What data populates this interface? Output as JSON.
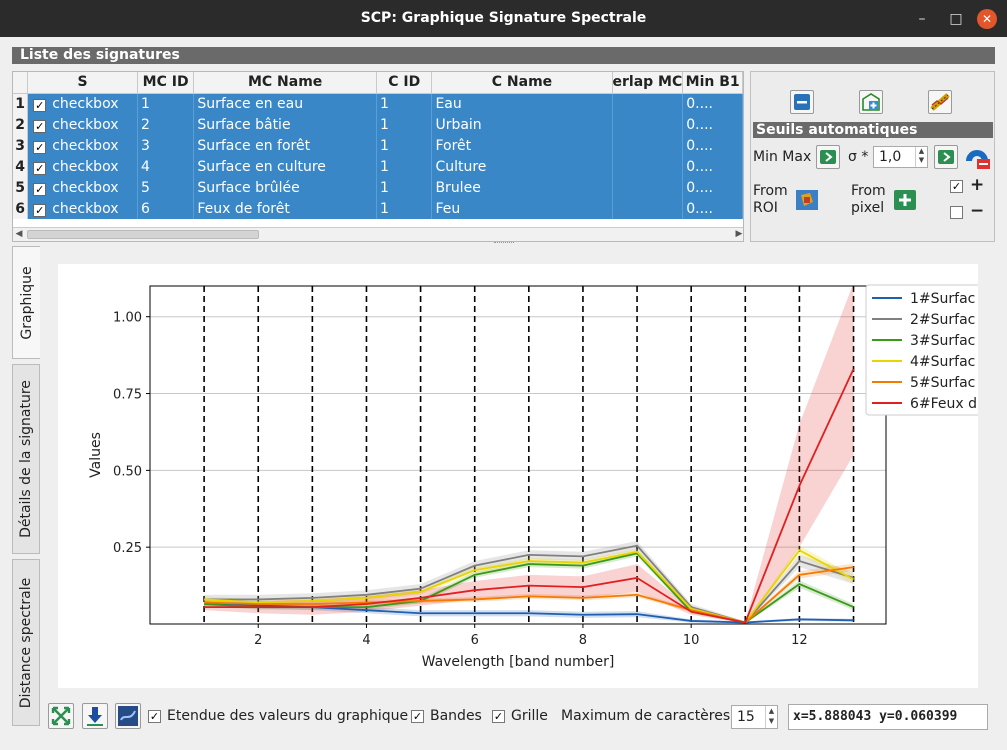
{
  "window": {
    "title": "SCP: Graphique Signature Spectrale",
    "min": "–",
    "max": "□",
    "close": "✕"
  },
  "list": {
    "title": "Liste des signatures",
    "columns": [
      "S",
      "MC ID",
      "MC Name",
      "C ID",
      "C Name",
      "erlap MC",
      "Min B1"
    ],
    "rows": [
      {
        "n": "1",
        "s": "checkbox",
        "mcid": "1",
        "mcname": "Surface en eau",
        "cid": "1",
        "cname": "Eau",
        "overlap": "",
        "min": "0...."
      },
      {
        "n": "2",
        "s": "checkbox",
        "mcid": "2",
        "mcname": "Surface bâtie",
        "cid": "1",
        "cname": "Urbain",
        "overlap": "",
        "min": "0...."
      },
      {
        "n": "3",
        "s": "checkbox",
        "mcid": "3",
        "mcname": "Surface en forêt",
        "cid": "1",
        "cname": "Forêt",
        "overlap": "",
        "min": "0...."
      },
      {
        "n": "4",
        "s": "checkbox",
        "mcid": "4",
        "mcname": "Surface en culture",
        "cid": "1",
        "cname": "Culture",
        "overlap": "",
        "min": "0...."
      },
      {
        "n": "5",
        "s": "checkbox",
        "mcid": "5",
        "mcname": "Surface brûlée",
        "cid": "1",
        "cname": "Brulee",
        "overlap": "",
        "min": "0...."
      },
      {
        "n": "6",
        "s": "checkbox",
        "mcid": "6",
        "mcname": "Feux de forêt",
        "cid": "1",
        "cname": "Feu",
        "overlap": "",
        "min": "0...."
      }
    ]
  },
  "seuils": {
    "title": "Seuils automatiques",
    "minmax_label": "Min Max",
    "sigma_label": "σ *",
    "sigma_value": "1,0",
    "from_roi": "From\nROI",
    "from_pixel": "From\npixel",
    "plus": "+",
    "minus": "−"
  },
  "tabs": [
    "Graphique",
    "Détails de la signature",
    "Distance spectrale"
  ],
  "bottom": {
    "etendue_label": "Etendue des valeurs du graphique",
    "bandes_label": "Bandes",
    "grille_label": "Grille",
    "maxchar_label": "Maximum de caractères",
    "maxchar_value": "15",
    "coords": "x=5.888043 y=0.060399"
  },
  "chart_data": {
    "type": "line",
    "xlabel": "Wavelength [band number]",
    "ylabel": "Values",
    "xlim": [
      0,
      13.6
    ],
    "ylim": [
      0,
      1.1
    ],
    "xticks": [
      2,
      4,
      6,
      8,
      10,
      12
    ],
    "yticks": [
      0.25,
      0.5,
      0.75,
      1.0
    ],
    "ytick_labels": [
      "0.25",
      "0.50",
      "0.75",
      "1.00"
    ],
    "band_lines": [
      1,
      2,
      3,
      4,
      5,
      6,
      7,
      8,
      9,
      10,
      11,
      12,
      13
    ],
    "grid": true,
    "legend_position": "top-right",
    "x": [
      1,
      2,
      3,
      4,
      5,
      6,
      7,
      8,
      9,
      10,
      11,
      12,
      13
    ],
    "series": [
      {
        "name": "1#Surfac",
        "color": "#1f5fb0",
        "values": [
          0.07,
          0.06,
          0.055,
          0.045,
          0.035,
          0.035,
          0.035,
          0.03,
          0.032,
          0.01,
          0.005,
          0.015,
          0.012
        ],
        "spread": [
          0.01,
          0.01,
          0.01,
          0.01,
          0.01,
          0.01,
          0.01,
          0.01,
          0.01,
          0.005,
          0.003,
          0.005,
          0.005
        ]
      },
      {
        "name": "2#Surfac",
        "color": "#808080",
        "values": [
          0.08,
          0.08,
          0.085,
          0.095,
          0.115,
          0.19,
          0.225,
          0.22,
          0.255,
          0.055,
          0.005,
          0.205,
          0.15
        ],
        "spread": [
          0.015,
          0.015,
          0.015,
          0.015,
          0.015,
          0.015,
          0.015,
          0.015,
          0.015,
          0.01,
          0.003,
          0.02,
          0.02
        ]
      },
      {
        "name": "3#Surfac",
        "color": "#3a9a1a",
        "values": [
          0.065,
          0.055,
          0.055,
          0.055,
          0.075,
          0.16,
          0.195,
          0.19,
          0.23,
          0.04,
          0.005,
          0.13,
          0.055
        ],
        "spread": [
          0.008,
          0.008,
          0.008,
          0.008,
          0.008,
          0.01,
          0.01,
          0.01,
          0.01,
          0.006,
          0.003,
          0.012,
          0.01
        ]
      },
      {
        "name": "4#Surfac",
        "color": "#e8d400",
        "values": [
          0.08,
          0.07,
          0.075,
          0.085,
          0.105,
          0.175,
          0.205,
          0.2,
          0.235,
          0.05,
          0.005,
          0.24,
          0.145
        ],
        "spread": [
          0.01,
          0.01,
          0.01,
          0.01,
          0.01,
          0.01,
          0.01,
          0.01,
          0.01,
          0.006,
          0.003,
          0.015,
          0.015
        ]
      },
      {
        "name": "5#Surfac",
        "color": "#f57a00",
        "values": [
          0.07,
          0.065,
          0.065,
          0.07,
          0.075,
          0.08,
          0.09,
          0.085,
          0.095,
          0.045,
          0.005,
          0.16,
          0.185
        ],
        "spread": [
          0.008,
          0.008,
          0.008,
          0.008,
          0.008,
          0.008,
          0.008,
          0.008,
          0.008,
          0.006,
          0.003,
          0.012,
          0.012
        ]
      },
      {
        "name": "6#Feux d",
        "color": "#e02020",
        "values": [
          0.055,
          0.055,
          0.055,
          0.065,
          0.085,
          0.11,
          0.125,
          0.12,
          0.15,
          0.04,
          0.005,
          0.45,
          0.83
        ],
        "spread": [
          0.01,
          0.02,
          0.025,
          0.025,
          0.025,
          0.03,
          0.035,
          0.035,
          0.045,
          0.01,
          0.003,
          0.2,
          0.28
        ]
      }
    ]
  }
}
